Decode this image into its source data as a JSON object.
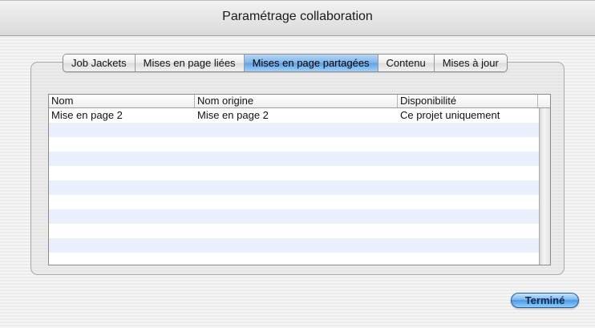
{
  "window": {
    "title": "Paramétrage collaboration"
  },
  "tabs": [
    {
      "label": "Job Jackets"
    },
    {
      "label": "Mises en page liées"
    },
    {
      "label": "Mises en page partagées",
      "selected": true
    },
    {
      "label": "Contenu"
    },
    {
      "label": "Mises à jour"
    }
  ],
  "table": {
    "columns": [
      "Nom",
      "Nom origine",
      "Disponibilité"
    ],
    "rows": [
      [
        "Mise en page 2",
        "Mise en page 2",
        "Ce projet uniquement"
      ]
    ]
  },
  "footer": {
    "done_label": "Terminé"
  },
  "colors": {
    "selected_tab": "#7fb4ea",
    "row_stripe": "#e9f0fb",
    "default_button": "#4c98e2"
  }
}
